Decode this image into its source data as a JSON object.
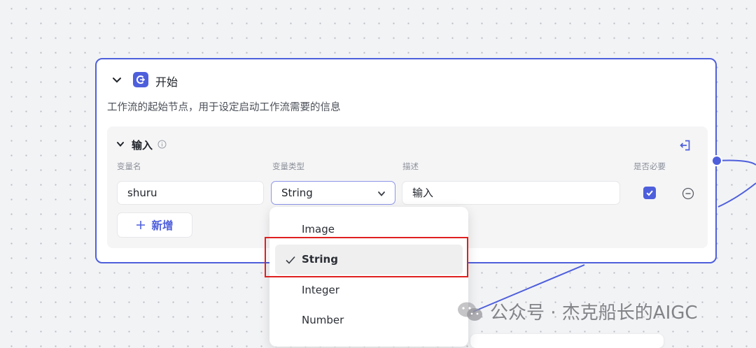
{
  "node": {
    "title": "开始",
    "description": "工作流的起始节点，用于设定启动工作流需要的信息"
  },
  "input_section": {
    "title": "输入",
    "columns": [
      "变量名",
      "变量类型",
      "描述",
      "是否必要"
    ],
    "row": {
      "name": "shuru",
      "type": "String",
      "description": "输入",
      "required": true
    },
    "add_label": "新增"
  },
  "type_dropdown": {
    "options": [
      "Image",
      "String",
      "Integer",
      "Number"
    ],
    "selected": "String"
  },
  "watermark": "公众号 · 杰克船长的AIGC",
  "colors": {
    "accent": "#4e5fdc",
    "highlight_box": "#e02020"
  }
}
